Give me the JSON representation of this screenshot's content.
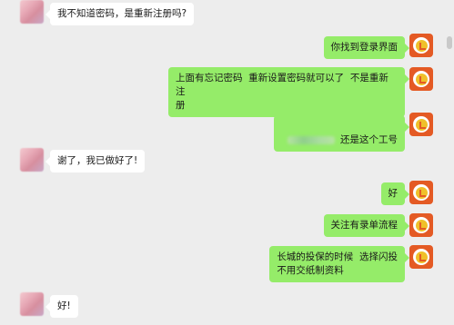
{
  "messages": [
    {
      "side": "left",
      "text": "我不知道密码，是重新注册吗?"
    },
    {
      "side": "right",
      "text": "你找到登录界面"
    },
    {
      "side": "right",
      "text": "上面有忘记密码  重新设置密码就可以了  不是重新注\n册"
    },
    {
      "side": "right",
      "text": "还是这个工号"
    },
    {
      "side": "left",
      "text": "谢了，我已做好了!"
    },
    {
      "side": "right",
      "text": "好"
    },
    {
      "side": "right",
      "text": "关注有录单流程"
    },
    {
      "side": "right",
      "text": "长城的投保的时候  选择闪投\n不用交纸制资料"
    },
    {
      "side": "left",
      "text": "好!"
    }
  ],
  "colors": {
    "background": "#ededed",
    "bubble_left": "#ffffff",
    "bubble_right": "#95ec69",
    "logo": "#e45a24"
  },
  "icons": {
    "agent_avatar": "orange-logo-icon",
    "user_avatar": "blurred-avatar"
  }
}
